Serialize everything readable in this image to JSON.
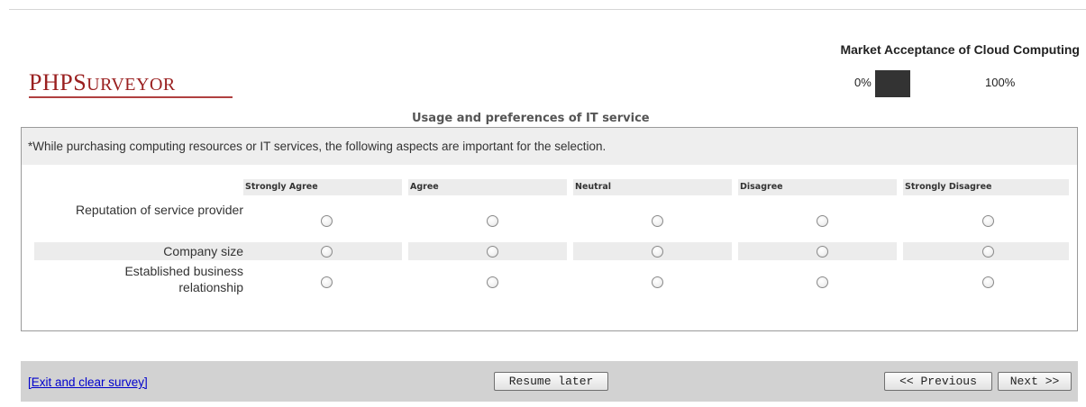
{
  "header": {
    "logo_text": "PHPSurveyor",
    "survey_title": "Market Acceptance of Cloud Computing",
    "progress": {
      "value_percent": 12,
      "left_label": "0%",
      "right_label": "100%"
    }
  },
  "group": {
    "title": "Usage and preferences of IT service"
  },
  "question": {
    "text": "*While purchasing computing resources or IT services, the following aspects are important for the selection.",
    "answers": [
      "Strongly Agree",
      "Agree",
      "Neutral",
      "Disagree",
      "Strongly Disagree"
    ],
    "rows": [
      {
        "label": "Reputation of service provider",
        "selected": null
      },
      {
        "label": "Company size",
        "selected": null
      },
      {
        "label": "Established business relationship",
        "selected": null
      }
    ]
  },
  "footer": {
    "exit_link": "[Exit and clear survey]",
    "resume_label": "Resume later",
    "previous_label": "<< Previous",
    "next_label": "Next >>"
  },
  "colors": {
    "logo": "#9a2020",
    "link": "#0000cc",
    "footer_bg": "#d2d2d2",
    "row_alt_bg": "#ececec",
    "progress_fill": "#333333"
  }
}
